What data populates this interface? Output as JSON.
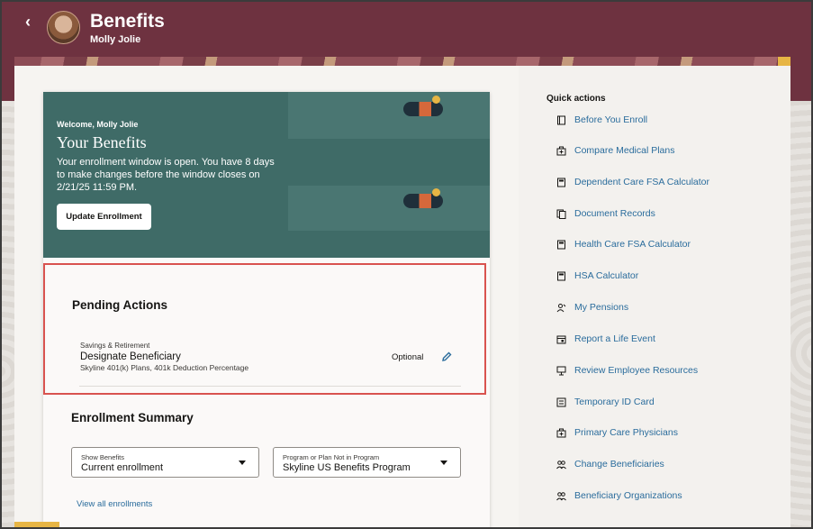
{
  "header": {
    "title": "Benefits",
    "user_name": "Molly Jolie"
  },
  "hero": {
    "greeting": "Welcome, Molly Jolie",
    "heading": "Your Benefits",
    "message": "Your enrollment window is open. You have 8 days to make changes before the window closes on 2/21/25 11:59 PM.",
    "button_label": "Update Enrollment"
  },
  "pending": {
    "title": "Pending Actions",
    "items": [
      {
        "category": "Savings & Retirement",
        "title": "Designate Beneficiary",
        "subtitle": "Skyline 401(k) Plans, 401k Deduction Percentage",
        "status": "Optional"
      }
    ]
  },
  "summary": {
    "title": "Enrollment Summary",
    "show_benefits": {
      "label": "Show Benefits",
      "value": "Current enrollment"
    },
    "program": {
      "label": "Program or Plan Not in Program",
      "value": "Skyline US Benefits Program"
    },
    "view_all": "View all enrollments"
  },
  "quick_actions": {
    "title": "Quick actions",
    "items": [
      {
        "label": "Before You Enroll",
        "icon": "document-icon"
      },
      {
        "label": "Compare Medical Plans",
        "icon": "medical-bag-icon"
      },
      {
        "label": "Dependent Care FSA Calculator",
        "icon": "calculator-icon"
      },
      {
        "label": "Document Records",
        "icon": "documents-icon"
      },
      {
        "label": "Health Care FSA Calculator",
        "icon": "calculator-icon"
      },
      {
        "label": "HSA Calculator",
        "icon": "calculator-icon"
      },
      {
        "label": "My Pensions",
        "icon": "person-icon"
      },
      {
        "label": "Report a Life Event",
        "icon": "calendar-icon"
      },
      {
        "label": "Review Employee Resources",
        "icon": "resources-icon"
      },
      {
        "label": "Temporary ID Card",
        "icon": "id-card-icon"
      },
      {
        "label": "Primary Care Physicians",
        "icon": "medical-bag-icon"
      },
      {
        "label": "Change Beneficiaries",
        "icon": "people-icon"
      },
      {
        "label": "Beneficiary Organizations",
        "icon": "people-icon"
      }
    ]
  },
  "colors": {
    "header_bg": "#6e3240",
    "hero_bg": "#3f6b67",
    "link": "#2a6c9c",
    "highlight_border": "#d9534f",
    "accent": "#e7b544"
  }
}
